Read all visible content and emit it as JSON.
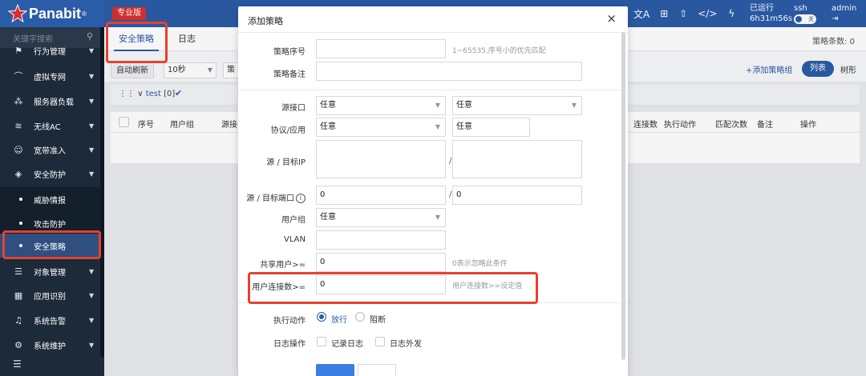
{
  "topbar": {
    "logo_text": "Panabit",
    "logo_reg": "®",
    "edition": "专业版",
    "icons": [
      "translate-icon",
      "grid-icon",
      "upload-icon",
      "code-icon",
      "flash-icon"
    ],
    "icon_glyphs": [
      "文A",
      "⊞",
      "⇧",
      "</>",
      "ϟ"
    ],
    "run_label": "已运行",
    "run_time": "6h31m56s",
    "ssh_label": "ssh",
    "ssh_toggle": "关",
    "user": "admin",
    "logout_glyph": "⇥"
  },
  "sidebar": {
    "search_placeholder": "关键字搜索",
    "items": [
      {
        "label": "行为管理",
        "icon": "⚑"
      },
      {
        "label": "虚拟专网",
        "icon": "⌒"
      },
      {
        "label": "服务器负载",
        "icon": "⁂"
      },
      {
        "label": "无线AC",
        "icon": "≋"
      },
      {
        "label": "宽带准入",
        "icon": "☺"
      },
      {
        "label": "安全防护",
        "icon": "◈"
      }
    ],
    "subitems": [
      {
        "label": "威胁情报"
      },
      {
        "label": "攻击防护"
      },
      {
        "label": "安全策略"
      }
    ],
    "items2": [
      {
        "label": "对象管理",
        "icon": "☰"
      },
      {
        "label": "应用识别",
        "icon": "▦"
      },
      {
        "label": "系统告警",
        "icon": "♫"
      },
      {
        "label": "系统维护",
        "icon": "⚙"
      }
    ],
    "collapse_glyph": "☰"
  },
  "content": {
    "tabs": [
      {
        "label": "安全策略"
      },
      {
        "label": "日志"
      }
    ],
    "policy_count": "策略条数: 0",
    "toolbar": {
      "refresh_label": "自动刷新",
      "interval": "10秒",
      "cut_label": "策",
      "add_group": "+添加策略组",
      "view_list": "列表",
      "view_tree": "树形"
    },
    "group": {
      "name": "test",
      "count": "[0]"
    },
    "columns_left": [
      "序号",
      "用户组",
      "源接"
    ],
    "columns_right": [
      "连接数",
      "执行动作",
      "匹配次数",
      "备注",
      "操作"
    ]
  },
  "modal": {
    "title": "添加策略",
    "close": "×",
    "fields": {
      "seq_label": "策略序号",
      "seq_hint": "1~65535,序号小的优先匹配",
      "remark_label": "策略备注",
      "src_if_label": "源接口",
      "src_if_value": "任意",
      "dst_if_value": "任意",
      "proto_label": "协议/应用",
      "proto_value": "任意",
      "app_value": "任意",
      "ip_label": "源 / 目标IP",
      "ip_sep": "/",
      "port_label": "源 / 目标端口",
      "port_src": "0",
      "port_sep": "/",
      "port_dst": "0",
      "usergroup_label": "用户组",
      "usergroup_value": "任意",
      "vlan_label": "VLAN",
      "share_label": "共享用户>=",
      "share_value": "0",
      "share_hint": "0表示忽略此条件",
      "conn_label": "用户连接数>=",
      "conn_value": "0",
      "conn_hint": "用户连接数>=设定值",
      "action_label": "执行动作",
      "action_allow": "放行",
      "action_block": "阻断",
      "log_label": "日志操作",
      "log_record": "记录日志",
      "log_send": "日志外发"
    }
  },
  "colors": {
    "accent": "#2b5ca8",
    "highlight": "#e8402f",
    "sidebar": "#1d2a3a"
  }
}
